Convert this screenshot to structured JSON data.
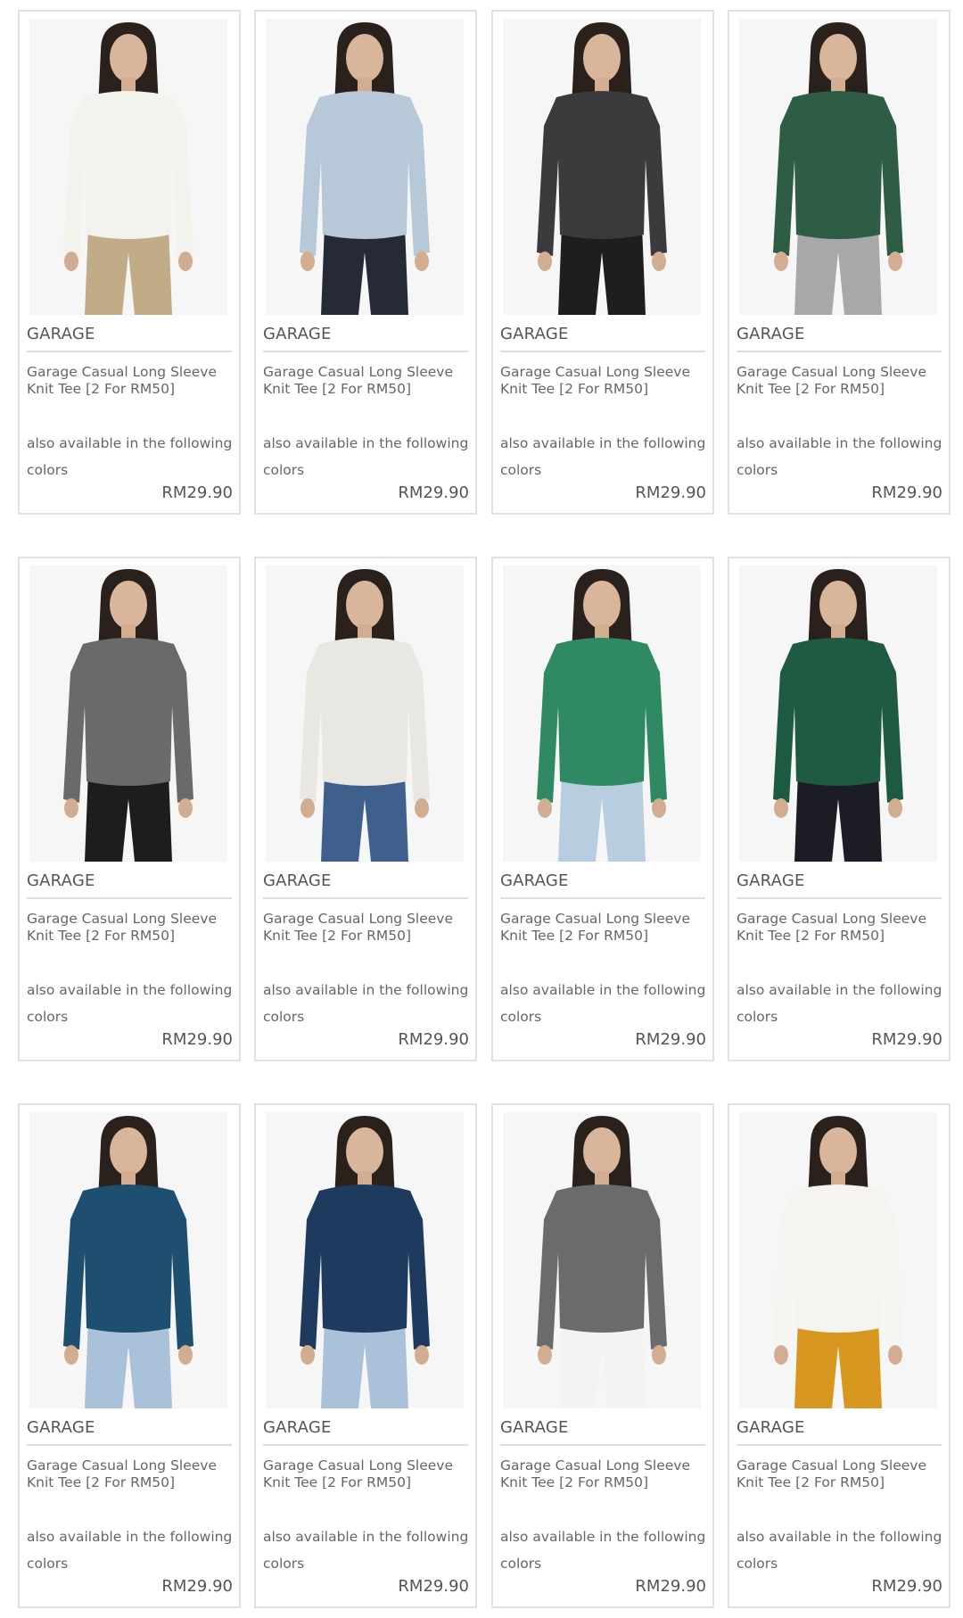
{
  "products": [
    {
      "brand": "GARAGE",
      "name": "Garage Casual Long Sleeve Knit Tee [2 For RM50]",
      "availability": "also available in the following colors",
      "price": "RM29.90",
      "top_color": "#f4f2ec",
      "bottom_color": "#c2ab87",
      "image_icon": "model-photo-icon"
    },
    {
      "brand": "GARAGE",
      "name": "Garage Casual Long Sleeve Knit Tee [2 For RM50]",
      "availability": "also available in the following colors",
      "price": "RM29.90",
      "top_color": "#b7c9d8",
      "bottom_color": "#262a36",
      "image_icon": "model-photo-icon"
    },
    {
      "brand": "GARAGE",
      "name": "Garage Casual Long Sleeve Knit Tee [2 For RM50]",
      "availability": "also available in the following colors",
      "price": "RM29.90",
      "top_color": "#3b3b3d",
      "bottom_color": "#1e1e20",
      "image_icon": "model-photo-icon"
    },
    {
      "brand": "GARAGE",
      "name": "Garage Casual Long Sleeve Knit Tee [2 For RM50]",
      "availability": "also available in the following colors",
      "price": "RM29.90",
      "top_color": "#2e5c44",
      "bottom_color": "#a8a8a8",
      "image_icon": "model-photo-icon"
    },
    {
      "brand": "GARAGE",
      "name": "Garage Casual Long Sleeve Knit Tee [2 For RM50]",
      "availability": "also available in the following colors",
      "price": "RM29.90",
      "top_color": "#6a6a6a",
      "bottom_color": "#1d1d1d",
      "image_icon": "model-photo-icon"
    },
    {
      "brand": "GARAGE",
      "name": "Garage Casual Long Sleeve Knit Tee [2 For RM50]",
      "availability": "also available in the following colors",
      "price": "RM29.90",
      "top_color": "#e9e7e2",
      "bottom_color": "#3f5f8c",
      "image_icon": "model-photo-icon"
    },
    {
      "brand": "GARAGE",
      "name": "Garage Casual Long Sleeve Knit Tee [2 For RM50]",
      "availability": "also available in the following colors",
      "price": "RM29.90",
      "top_color": "#2f8a64",
      "bottom_color": "#b9cde0",
      "image_icon": "model-photo-icon"
    },
    {
      "brand": "GARAGE",
      "name": "Garage Casual Long Sleeve Knit Tee [2 For RM50]",
      "availability": "also available in the following colors",
      "price": "RM29.90",
      "top_color": "#1f5a42",
      "bottom_color": "#1c1c24",
      "image_icon": "model-photo-icon"
    },
    {
      "brand": "GARAGE",
      "name": "Garage Casual Long Sleeve Knit Tee [2 For RM50]",
      "availability": "also available in the following colors",
      "price": "RM29.90",
      "top_color": "#1e4f70",
      "bottom_color": "#a9c2da",
      "image_icon": "model-photo-icon"
    },
    {
      "brand": "GARAGE",
      "name": "Garage Casual Long Sleeve Knit Tee [2 For RM50]",
      "availability": "also available in the following colors",
      "price": "RM29.90",
      "top_color": "#1f3a5f",
      "bottom_color": "#a9c2da",
      "image_icon": "model-photo-icon"
    },
    {
      "brand": "GARAGE",
      "name": "Garage Casual Long Sleeve Knit Tee [2 For RM50]",
      "availability": "also available in the following colors",
      "price": "RM29.90",
      "top_color": "#6b6b6d",
      "bottom_color": "#f3f3f1",
      "image_icon": "model-photo-icon"
    },
    {
      "brand": "GARAGE",
      "name": "Garage Casual Long Sleeve Knit Tee [2 For RM50]",
      "availability": "also available in the following colors",
      "price": "RM29.90",
      "top_color": "#f5f4f0",
      "bottom_color": "#d8971f",
      "image_icon": "model-photo-icon"
    }
  ]
}
